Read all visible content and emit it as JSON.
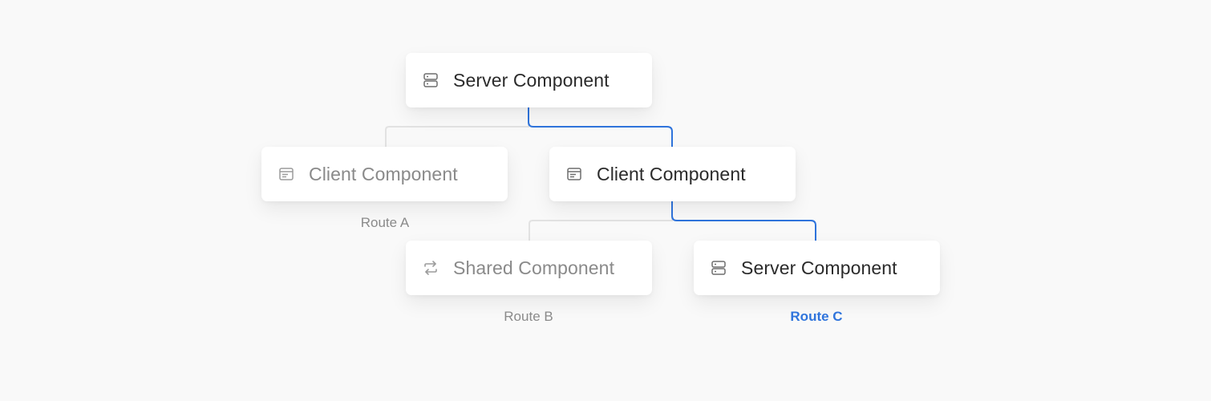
{
  "diagram": {
    "nodes": [
      {
        "id": "top",
        "label": "Server Component",
        "icon": "server-icon",
        "state": "active"
      },
      {
        "id": "mid-a",
        "label": "Client Component",
        "icon": "client-icon",
        "state": "dim"
      },
      {
        "id": "mid-b",
        "label": "Client Component",
        "icon": "client-icon",
        "state": "active"
      },
      {
        "id": "low-b",
        "label": "Shared Component",
        "icon": "shared-icon",
        "state": "dim"
      },
      {
        "id": "low-c",
        "label": "Server Component",
        "icon": "server-icon",
        "state": "active"
      }
    ],
    "routes": [
      {
        "id": "a",
        "label": "Route A",
        "state": "dim"
      },
      {
        "id": "b",
        "label": "Route B",
        "state": "dim"
      },
      {
        "id": "c",
        "label": "Route C",
        "state": "active"
      }
    ],
    "edges": [
      {
        "from": "top",
        "to": "mid-a",
        "state": "dim"
      },
      {
        "from": "top",
        "to": "mid-b",
        "state": "active"
      },
      {
        "from": "mid-b",
        "to": "low-b",
        "state": "dim"
      },
      {
        "from": "mid-b",
        "to": "low-c",
        "state": "active"
      }
    ]
  },
  "colors": {
    "background": "#f9f9f9",
    "card": "#ffffff",
    "active_line": "#2f74dc",
    "dim_line": "#e2e2e2",
    "active_text": "#2b2b2b",
    "dim_text": "#8a8a8a",
    "route_active": "#2f74dc"
  }
}
